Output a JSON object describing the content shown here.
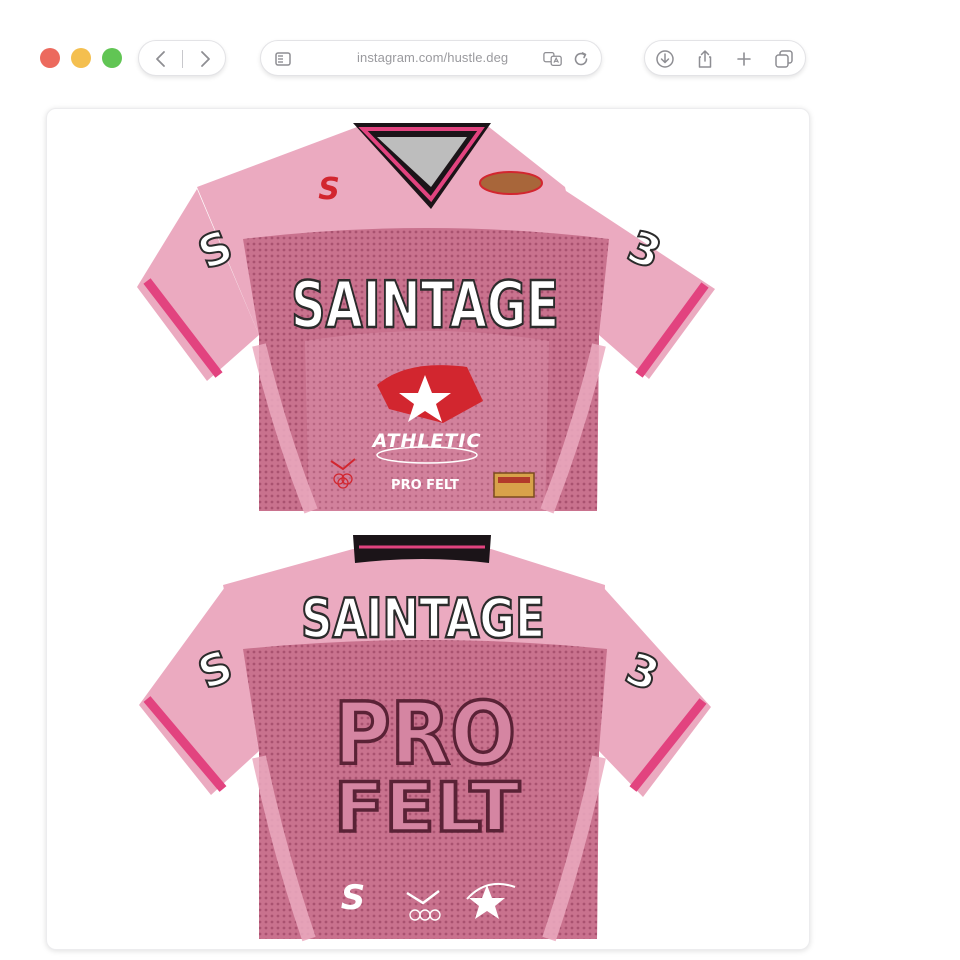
{
  "browser": {
    "url": "instagram.com/hustle.deg",
    "traffic_lights": {
      "close": "#ec6a5e",
      "minimize": "#f4bf4f",
      "zoom": "#61c554"
    },
    "icons": [
      "sidebar-icon",
      "back-icon",
      "forward-icon",
      "translate-icon",
      "reload-icon",
      "download-icon",
      "share-icon",
      "new-tab-icon",
      "tab-overview-icon"
    ]
  },
  "post": {
    "front": {
      "brand": "SAINTAGE",
      "sleeve_left": "S",
      "sleeve_right": "3",
      "badge_small": "S",
      "logo_word": "ATHLETIC",
      "logo_sub": "PRO FELT"
    },
    "back": {
      "brand": "SAINTAGE",
      "sleeve_left": "S",
      "sleeve_right": "3",
      "line1": "PRO",
      "line2": "FELT",
      "badge_small": "S"
    },
    "colors": {
      "jersey_light": "#ebaac0",
      "jersey_mesh": "#c9728e",
      "stripe": "#e2437f",
      "collar": "#1b1418",
      "accent_red": "#d2262f",
      "text_white": "#ffffff",
      "text_outline": "#2b2b2b"
    }
  }
}
